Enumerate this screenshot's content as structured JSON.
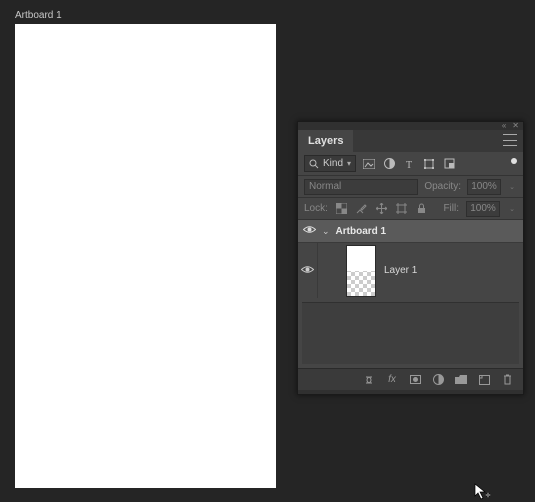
{
  "canvas": {
    "artboard_label": "Artboard 1"
  },
  "layers_panel": {
    "tab_title": "Layers",
    "filter": {
      "kind_label": "Kind"
    },
    "blend": {
      "mode": "Normal",
      "opacity_label": "Opacity:",
      "opacity_value": "100%",
      "fill_label": "Fill:",
      "fill_value": "100%"
    },
    "lock": {
      "label": "Lock:"
    },
    "tree": {
      "artboard": {
        "name": "Artboard 1"
      },
      "layers": [
        {
          "name": "Layer 1"
        }
      ]
    },
    "footer": {
      "link_label": "Link layers",
      "fx_label": "fx"
    }
  }
}
